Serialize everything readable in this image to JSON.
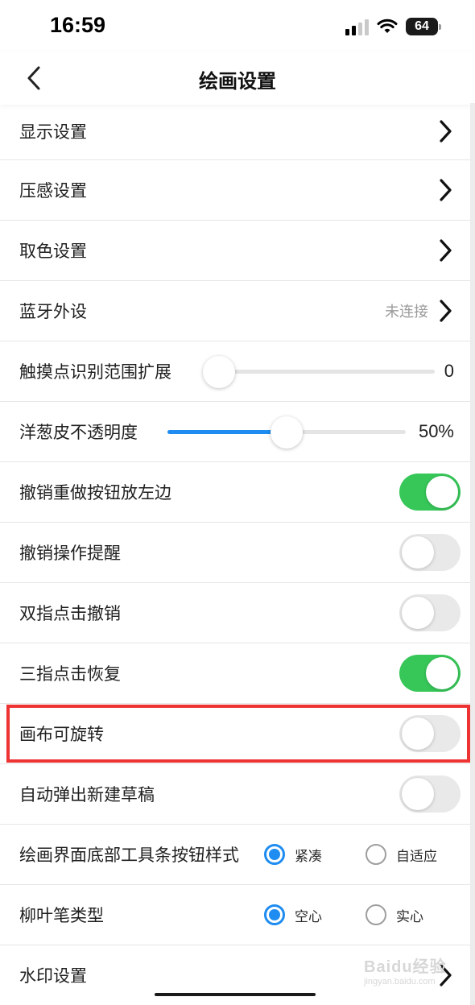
{
  "status_bar": {
    "time": "16:59",
    "battery": "64"
  },
  "nav": {
    "title": "绘画设置"
  },
  "rows": {
    "display": {
      "label": "显示设置"
    },
    "pressure": {
      "label": "压感设置"
    },
    "color_pick": {
      "label": "取色设置"
    },
    "bluetooth": {
      "label": "蓝牙外设",
      "status": "未连接"
    },
    "touch_range": {
      "label": "触摸点识别范围扩展",
      "value_text": "0",
      "fraction": 0
    },
    "onion_skin": {
      "label": "洋葱皮不透明度",
      "value_text": "50%",
      "fraction": 0.5
    },
    "undo_left": {
      "label": "撤销重做按钮放左边",
      "on": true
    },
    "undo_alert": {
      "label": "撤销操作提醒",
      "on": false
    },
    "two_finger_undo": {
      "label": "双指点击撤销",
      "on": false
    },
    "three_finger_redo": {
      "label": "三指点击恢复",
      "on": true
    },
    "canvas_rotate": {
      "label": "画布可旋转",
      "on": false
    },
    "auto_new_draft": {
      "label": "自动弹出新建草稿",
      "on": false
    },
    "toolbar_style": {
      "label": "绘画界面底部工具条按钮样式",
      "options": [
        "紧凑",
        "自适应"
      ],
      "selected": 0
    },
    "willow_pen": {
      "label": "柳叶笔类型",
      "options": [
        "空心",
        "实心"
      ],
      "selected": 0
    },
    "watermark": {
      "label": "水印设置"
    }
  },
  "watermark_overlay": {
    "brand": "Baidu经验",
    "url": "jingyan.baidu.com"
  },
  "colors": {
    "accent": "#1e8cf0",
    "toggle_on": "#37c759",
    "highlight": "#ee3333"
  },
  "icons": [
    "back-icon",
    "chevron-right-icon",
    "wifi-icon",
    "signal-icon",
    "battery-icon"
  ]
}
